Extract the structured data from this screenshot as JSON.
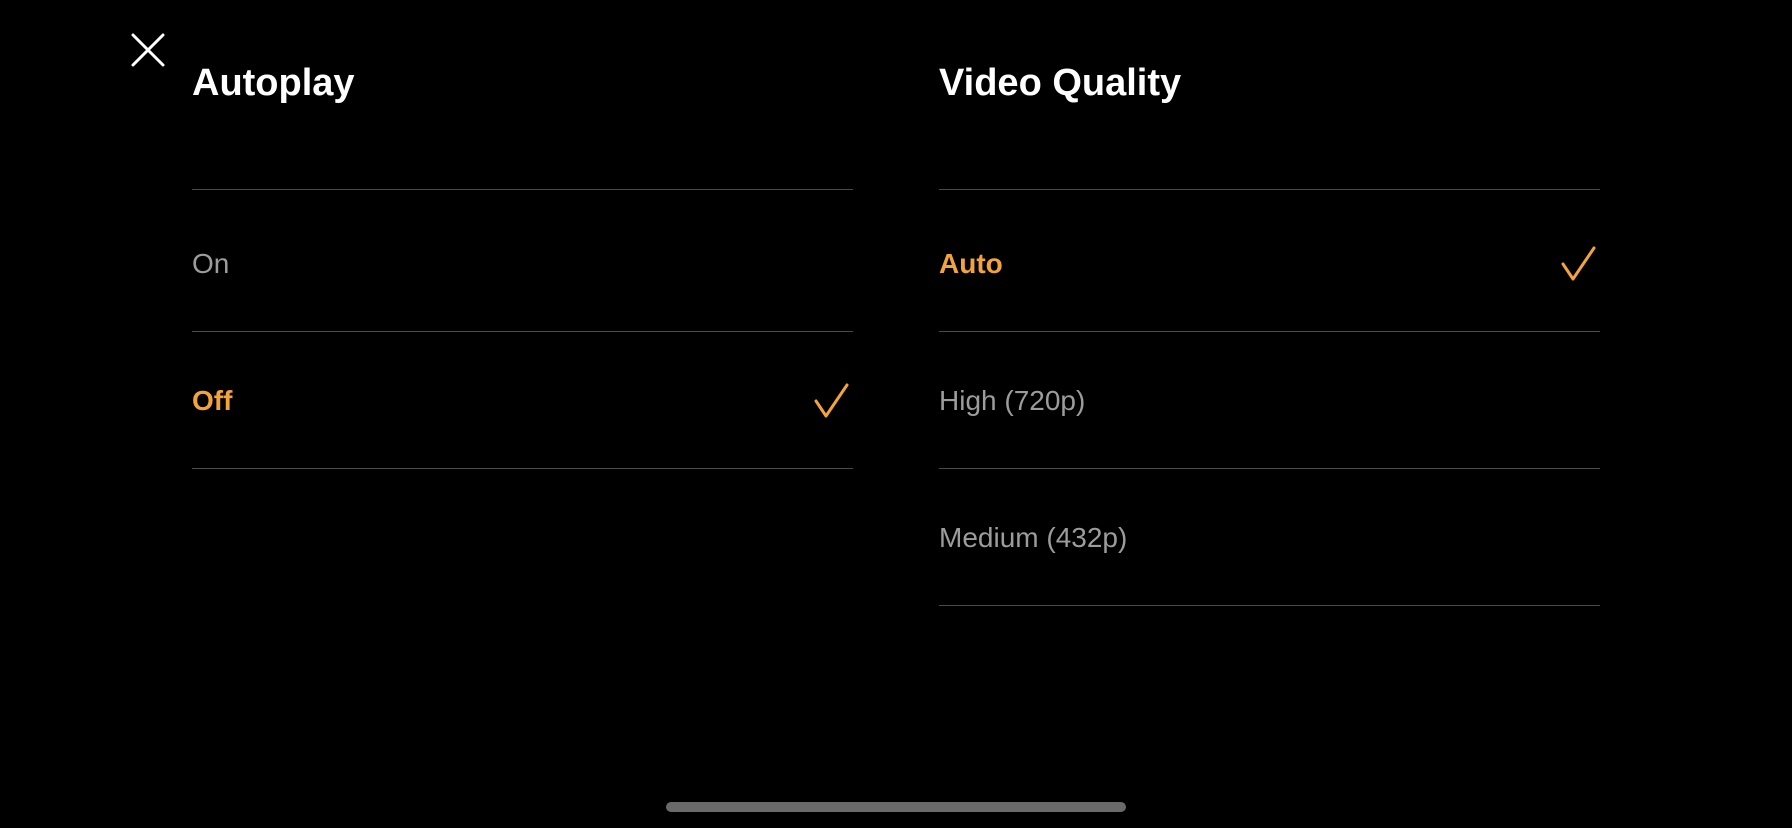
{
  "close": {
    "icon": "close-icon"
  },
  "autoplay": {
    "title": "Autoplay",
    "options": [
      {
        "label": "On",
        "selected": false
      },
      {
        "label": "Off",
        "selected": true
      }
    ]
  },
  "video_quality": {
    "title": "Video Quality",
    "options": [
      {
        "label": "Auto",
        "selected": true
      },
      {
        "label": "High (720p)",
        "selected": false
      },
      {
        "label": "Medium (432p)",
        "selected": false
      }
    ]
  },
  "colors": {
    "background": "#000000",
    "accent": "#f2a33a",
    "text_primary": "#ffffff",
    "text_secondary": "#9c9c9c",
    "divider": "#4a4a4a"
  },
  "icons": {
    "close": "close-icon",
    "check": "checkmark-icon"
  }
}
